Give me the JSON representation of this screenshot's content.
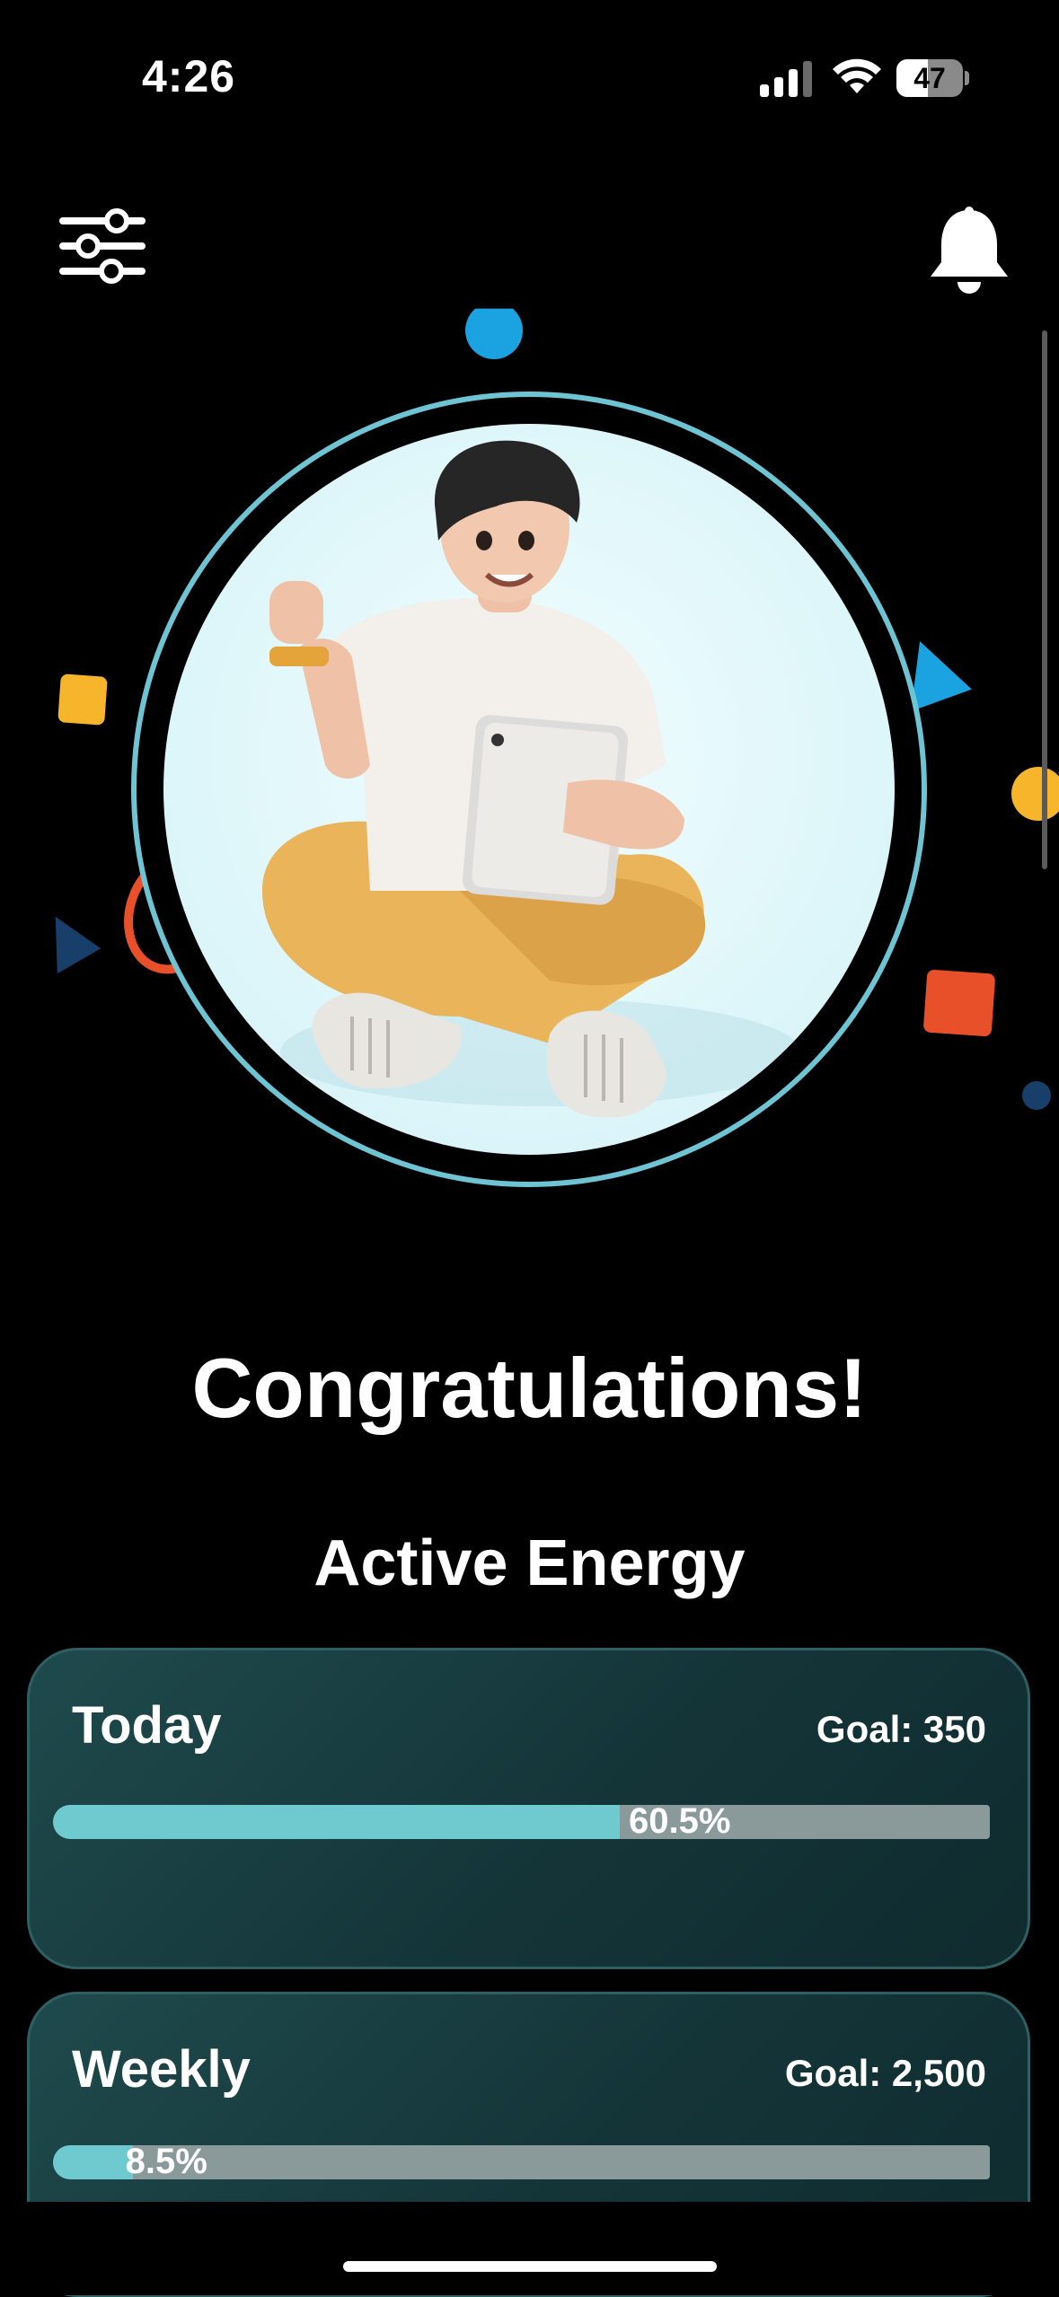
{
  "status_bar": {
    "time": "4:26",
    "battery_level": "47",
    "battery_fraction": 0.47
  },
  "toolbar": {
    "filter_icon": "sliders-icon",
    "notification_icon": "bell-icon"
  },
  "hero": {
    "illustration": "3D man sitting cross-legged celebrating with a tablet",
    "ring_color": "#6fc4d4"
  },
  "headline": "Congratulations!",
  "metric_title": "Active Energy",
  "cards": [
    {
      "label": "Today",
      "goal": "Goal: 350",
      "percent_text": "60.5%",
      "fraction": 0.605
    },
    {
      "label": "Weekly",
      "goal": "Goal: 2,500",
      "percent_text": "8.5%",
      "fraction": 0.085
    }
  ],
  "colors": {
    "accent": "#6fcacf",
    "track": "#8a9a9a",
    "card_bg": "#143538",
    "background": "#000000"
  }
}
